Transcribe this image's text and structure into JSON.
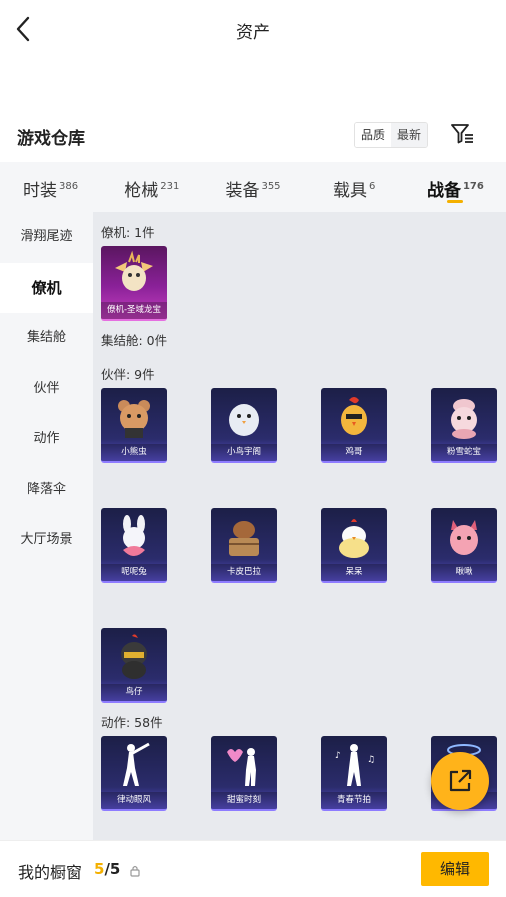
{
  "header": {
    "title": "资产"
  },
  "warehouse": {
    "title": "游戏仓库",
    "sort_quality": "品质",
    "sort_latest": "最新"
  },
  "tabs": [
    {
      "label": "时装",
      "count": "386"
    },
    {
      "label": "枪械",
      "count": "231"
    },
    {
      "label": "装备",
      "count": "355"
    },
    {
      "label": "载具",
      "count": "6"
    },
    {
      "label": "战备",
      "count": "176",
      "active": true
    }
  ],
  "sidebar": {
    "items": [
      {
        "label": "滑翔尾迹"
      },
      {
        "label": "僚机",
        "active": true
      },
      {
        "label": "集结舱"
      },
      {
        "label": "伙伴"
      },
      {
        "label": "动作"
      },
      {
        "label": "降落伞"
      },
      {
        "label": "大厅场景"
      }
    ]
  },
  "sections": {
    "wingman": {
      "label": "僚机: 1件",
      "items": [
        {
          "name": "僚机-圣域龙宝",
          "rarity": "pink"
        }
      ]
    },
    "capsule": {
      "label": "集结舱: 0件"
    },
    "partner": {
      "label": "伙伴: 9件",
      "items": [
        {
          "name": "小熊虫"
        },
        {
          "name": "小鸟宇阁"
        },
        {
          "name": "鸡哥"
        },
        {
          "name": "粉雪蛇宝"
        },
        {
          "name": "呢呢兔"
        },
        {
          "name": "卡皮巴拉"
        },
        {
          "name": "呆呆"
        },
        {
          "name": "啾啾"
        },
        {
          "name": "鸟仔"
        }
      ]
    },
    "action": {
      "label": "动作: 58件",
      "items": [
        {
          "name": "律动眼风"
        },
        {
          "name": "甜蜜时刻"
        },
        {
          "name": "青春节拍"
        },
        {
          "name": ""
        }
      ]
    }
  },
  "bottom": {
    "label": "我的橱窗",
    "current": "5",
    "sep_total": "/5",
    "edit": "编辑"
  },
  "colors": {
    "accent": "#ffb800",
    "card_blue": "#2b2c6c",
    "card_pink": "#8a2198"
  }
}
